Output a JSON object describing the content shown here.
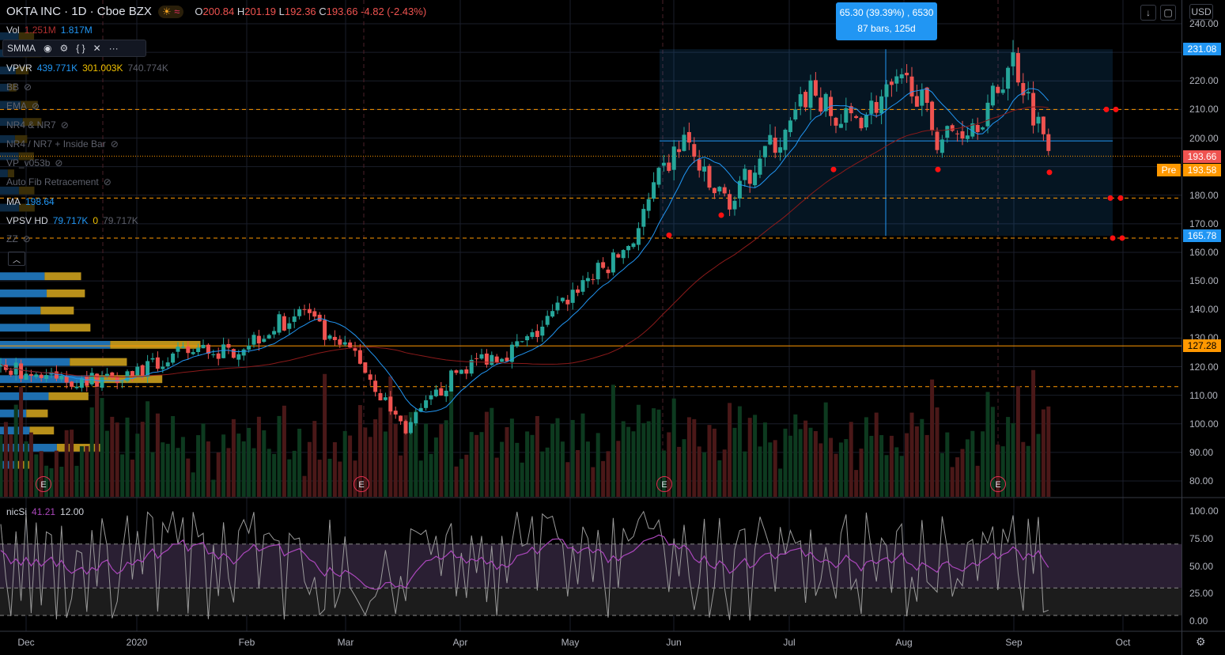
{
  "header": {
    "symbol": "OKTA INC · 1D · Cboe BZX",
    "open_label": "O",
    "open": "200.84",
    "high_label": "H",
    "high": "201.19",
    "low_label": "L",
    "low": "192.36",
    "close_label": "C",
    "close": "193.66",
    "change": "-4.82 (-2.43%)"
  },
  "indicators": {
    "vol": {
      "name": "Vol",
      "v1": "1.251M",
      "v2": "1.817M"
    },
    "smma": {
      "name": "SMMA"
    },
    "vpvr": {
      "name": "VPVR",
      "up": "439.771K",
      "down": "301.003K",
      "total": "740.774K"
    },
    "hidden": [
      "BB",
      "EMA",
      "NR4 & NR7",
      "NR4 / NR7 + Inside Bar",
      "VP_v053b",
      "Auto Fib Retracement"
    ],
    "ma": {
      "name": "MA",
      "value": "198.64"
    },
    "vpsv": {
      "name": "VPSV HD",
      "v1": "79.717K",
      "v2": "0",
      "v3": "79.717K"
    },
    "zz": {
      "name": "ZZ"
    },
    "nicsi": {
      "name": "nicSi",
      "v1": "41.21",
      "v2": "12.00"
    }
  },
  "measure": {
    "line1": "65.30 (39.39%) , 6530",
    "line2": "87 bars, 125d"
  },
  "toolbar": {
    "currency": "USD",
    "scroll_icon": "arrow-down-icon",
    "fullscreen_icon": "fullscreen-icon"
  },
  "earnings_label": "E",
  "colors": {
    "up": "#26a69a",
    "down": "#ef5350",
    "accent": "#2196f3",
    "orange": "#ff9800"
  },
  "chart_data": {
    "type": "candlestick",
    "title": "OKTA INC · 1D · Cboe BZX",
    "price_axis": {
      "ylim": [
        75,
        240
      ],
      "ticks": [
        "240.00",
        "220.00",
        "210.00",
        "200.00",
        "180.00",
        "170.00",
        "160.00",
        "150.00",
        "140.00",
        "130.00",
        "120.00",
        "110.00",
        "100.00",
        "90.00",
        "80.00"
      ]
    },
    "price_tags": [
      {
        "label": "231.08",
        "kind": "range-high"
      },
      {
        "label": "193.66",
        "kind": "last"
      },
      {
        "label": "193.58",
        "kind": "pre",
        "prefix": "Pre"
      },
      {
        "label": "165.78",
        "kind": "range-low"
      },
      {
        "label": "127.28",
        "kind": "line"
      }
    ],
    "x_ticks": [
      "Dec",
      "2020",
      "Feb",
      "Mar",
      "Apr",
      "May",
      "Jun",
      "Jul",
      "Aug",
      "Sep",
      "Oct"
    ],
    "weekly_closes": [
      120,
      118,
      116,
      115,
      116,
      118,
      120,
      124,
      126,
      125,
      130,
      135,
      140,
      128,
      125,
      110,
      98,
      108,
      118,
      123,
      125,
      130,
      140,
      150,
      155,
      165,
      185,
      200,
      182,
      178,
      195,
      200,
      218,
      205,
      208,
      215,
      220,
      200,
      203,
      210,
      228,
      205,
      193.66
    ],
    "horizontal_levels": [
      210,
      193.66,
      179,
      127.28,
      113,
      165
    ],
    "oscillator": {
      "name": "nicSi",
      "ylim": [
        0,
        100
      ],
      "ticks": [
        "100.00",
        "75.00",
        "50.00",
        "25.00",
        "0.00"
      ],
      "bands": [
        70,
        30,
        5
      ],
      "last": [
        41.21,
        12.0
      ]
    }
  }
}
